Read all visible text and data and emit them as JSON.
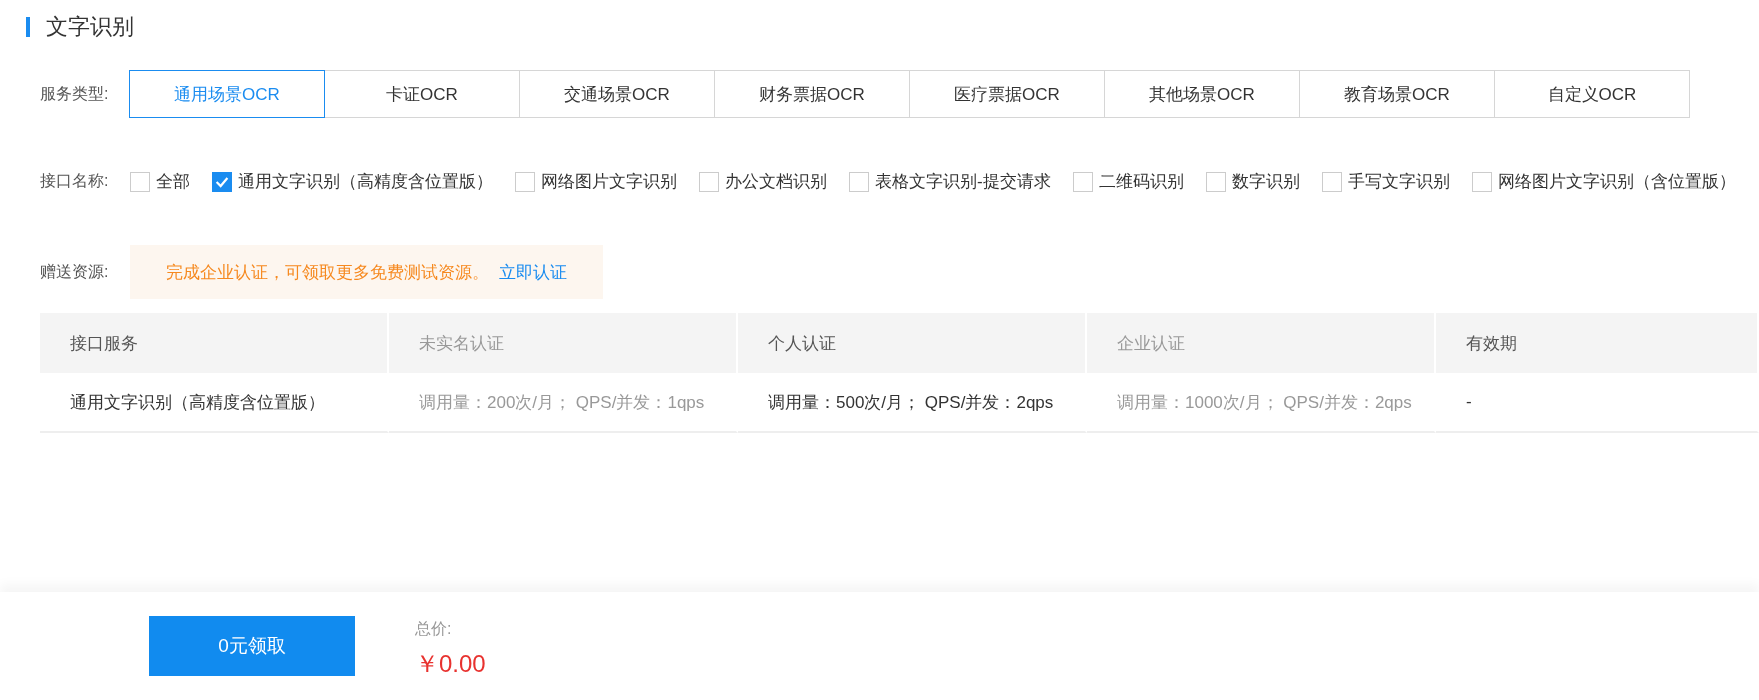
{
  "title": "文字识别",
  "service_type": {
    "label": "服务类型:",
    "tabs": [
      {
        "label": "通用场景OCR",
        "selected": true
      },
      {
        "label": "卡证OCR",
        "selected": false
      },
      {
        "label": "交通场景OCR",
        "selected": false
      },
      {
        "label": "财务票据OCR",
        "selected": false
      },
      {
        "label": "医疗票据OCR",
        "selected": false
      },
      {
        "label": "其他场景OCR",
        "selected": false
      },
      {
        "label": "教育场景OCR",
        "selected": false
      },
      {
        "label": "自定义OCR",
        "selected": false
      }
    ]
  },
  "api_name": {
    "label": "接口名称:",
    "options": [
      {
        "label": "全部",
        "checked": false
      },
      {
        "label": "通用文字识别（高精度含位置版）",
        "checked": true
      },
      {
        "label": "网络图片文字识别",
        "checked": false
      },
      {
        "label": "办公文档识别",
        "checked": false
      },
      {
        "label": "表格文字识别-提交请求",
        "checked": false
      },
      {
        "label": "二维码识别",
        "checked": false
      },
      {
        "label": "数字识别",
        "checked": false
      },
      {
        "label": "手写文字识别",
        "checked": false
      },
      {
        "label": "网络图片文字识别（含位置版）",
        "checked": false
      }
    ]
  },
  "gift": {
    "label": "赠送资源:",
    "notice": "完成企业认证，可领取更多免费测试资源。",
    "link": "立即认证"
  },
  "table": {
    "columns": [
      {
        "label": "接口服务",
        "muted": false
      },
      {
        "label": "未实名认证",
        "muted": true
      },
      {
        "label": "个人认证",
        "muted": false
      },
      {
        "label": "企业认证",
        "muted": true
      },
      {
        "label": "有效期",
        "muted": false
      }
    ],
    "rows": [
      [
        "通用文字识别（高精度含位置版）",
        "调用量：200次/月； QPS/并发：1qps",
        "调用量：500次/月； QPS/并发：2qps",
        "调用量：1000次/月； QPS/并发：2qps",
        "-"
      ]
    ]
  },
  "footer": {
    "button": "0元领取",
    "total_label": "总价:",
    "total": "￥0.00"
  }
}
